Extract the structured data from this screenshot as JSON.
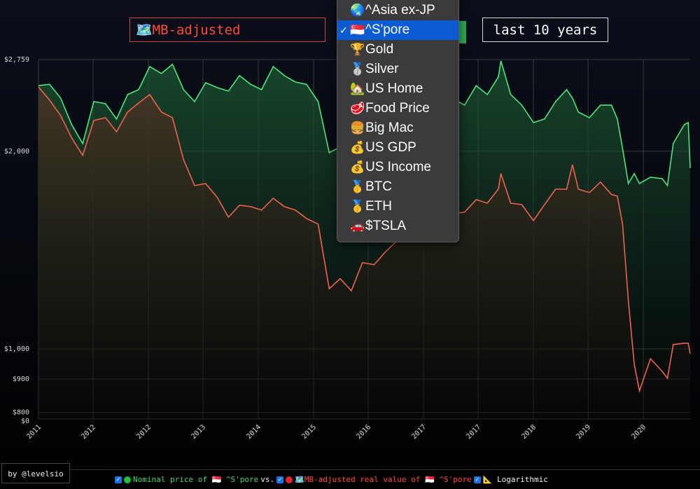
{
  "controls": {
    "adjust_label": "MB-adjusted",
    "adjust_icon": "🗺️",
    "range_label": "last 10 years"
  },
  "menu": {
    "items": [
      {
        "icon": "🌏",
        "label": "^Asia ex-JP",
        "selected": false
      },
      {
        "icon": "🇸🇬",
        "label": "^S'pore",
        "selected": true
      },
      {
        "icon": "🏆",
        "label": "Gold",
        "selected": false
      },
      {
        "icon": "🥈",
        "label": "Silver",
        "selected": false
      },
      {
        "icon": "🏡",
        "label": "US Home",
        "selected": false
      },
      {
        "icon": "🥩",
        "label": "Food Price",
        "selected": false
      },
      {
        "icon": "🍔",
        "label": "Big Mac",
        "selected": false
      },
      {
        "icon": "💰",
        "label": "US GDP",
        "selected": false
      },
      {
        "icon": "💰",
        "label": "US Income",
        "selected": false
      },
      {
        "icon": "🥇",
        "label": "BTC",
        "selected": false
      },
      {
        "icon": "🥇",
        "label": "ETH",
        "selected": false
      },
      {
        "icon": "🚗",
        "label": "$TSLA",
        "selected": false
      }
    ],
    "check": "✓"
  },
  "footer": {
    "byline": "by @levelsio",
    "legend_nominal": "Nominal price of 🇸🇬 ^S'pore",
    "legend_vs": "vs.",
    "legend_real": "🗺️MB-adjusted real value of 🇸🇬 ^S'pore",
    "legend_log": "📐 Logarithmic"
  },
  "colors": {
    "nominal": "#4ee57a",
    "real": "#f0624d",
    "selected": "#0b5bd3"
  },
  "chart_data": {
    "type": "area",
    "scale": "log",
    "ylim": [
      782,
      2759
    ],
    "xlim": [
      2010.92,
      2020.94
    ],
    "yticks": [
      {
        "v": 2759,
        "label": "$2,759"
      },
      {
        "v": 2000,
        "label": "$2,000"
      },
      {
        "v": 1000,
        "label": "$1,000"
      },
      {
        "v": 900,
        "label": "$900"
      },
      {
        "v": 800,
        "label": "$800"
      },
      {
        "v": 782,
        "label": "$0"
      }
    ],
    "xticks": [
      {
        "v": 2010.92,
        "label": "2011"
      },
      {
        "v": 2011.76,
        "label": "2012"
      },
      {
        "v": 2012.61,
        "label": "2012"
      },
      {
        "v": 2013.45,
        "label": "2013"
      },
      {
        "v": 2014.3,
        "label": "2014"
      },
      {
        "v": 2015.15,
        "label": "2015"
      },
      {
        "v": 2015.99,
        "label": "2016"
      },
      {
        "v": 2016.84,
        "label": "2017"
      },
      {
        "v": 2017.68,
        "label": "2017"
      },
      {
        "v": 2018.53,
        "label": "2018"
      },
      {
        "v": 2019.37,
        "label": "2019"
      },
      {
        "v": 2020.22,
        "label": "2020"
      }
    ],
    "x": [
      2010.92,
      2011.09,
      2011.26,
      2011.43,
      2011.6,
      2011.77,
      2011.95,
      2012.12,
      2012.29,
      2012.46,
      2012.63,
      2012.81,
      2012.98,
      2013.15,
      2013.32,
      2013.49,
      2013.67,
      2013.84,
      2014.01,
      2014.18,
      2014.35,
      2014.53,
      2014.7,
      2014.87,
      2015.04,
      2015.22,
      2015.39,
      2015.56,
      2015.73,
      2015.9,
      2016.08,
      2016.25,
      2016.42,
      2016.59,
      2016.76,
      2016.94,
      2017.11,
      2017.28,
      2017.47,
      2017.65,
      2017.82,
      2017.99,
      2018.03,
      2018.18,
      2018.35,
      2018.53,
      2018.7,
      2018.87,
      2019.04,
      2019.13,
      2019.22,
      2019.39,
      2019.56,
      2019.73,
      2019.82,
      2019.9,
      2019.99,
      2020.08,
      2020.16,
      2020.33,
      2020.51,
      2020.59,
      2020.68,
      2020.85,
      2020.91,
      2020.94
    ],
    "series": [
      {
        "name": "Nominal price of ^S'pore",
        "color": "#4ee57a",
        "values": [
          2518,
          2530,
          2410,
          2196,
          2055,
          2381,
          2363,
          2239,
          2440,
          2483,
          2692,
          2627,
          2713,
          2483,
          2381,
          2544,
          2500,
          2470,
          2608,
          2530,
          2483,
          2692,
          2608,
          2550,
          2530,
          2381,
          1990,
          2030,
          1956,
          1709,
          1817,
          1886,
          2005,
          2106,
          2212,
          2295,
          2351,
          2410,
          2351,
          2518,
          2440,
          2594,
          2746,
          2440,
          2351,
          2212,
          2239,
          2381,
          2483,
          2410,
          2295,
          2250,
          2351,
          2351,
          2239,
          2020,
          1786,
          1849,
          1786,
          1826,
          1817,
          1773,
          2055,
          2196,
          2212,
          1886
        ]
      },
      {
        "name": "MB-adjusted real value of ^S'pore",
        "color": "#f0624d",
        "values": [
          2506,
          2393,
          2267,
          2096,
          1971,
          2228,
          2250,
          2142,
          2295,
          2369,
          2440,
          2295,
          2250,
          1942,
          1773,
          1786,
          1700,
          1587,
          1655,
          1647,
          1627,
          1696,
          1647,
          1627,
          1580,
          1549,
          1235,
          1279,
          1226,
          1353,
          1343,
          1404,
          1457,
          1475,
          1457,
          1512,
          1549,
          1607,
          1615,
          1688,
          1667,
          1751,
          1849,
          1667,
          1659,
          1568,
          1659,
          1751,
          1751,
          1908,
          1751,
          1730,
          1795,
          1718,
          1709,
          1549,
          1182,
          947,
          863,
          966,
          924,
          902,
          1015,
          1020,
          1020,
          983
        ]
      }
    ]
  }
}
